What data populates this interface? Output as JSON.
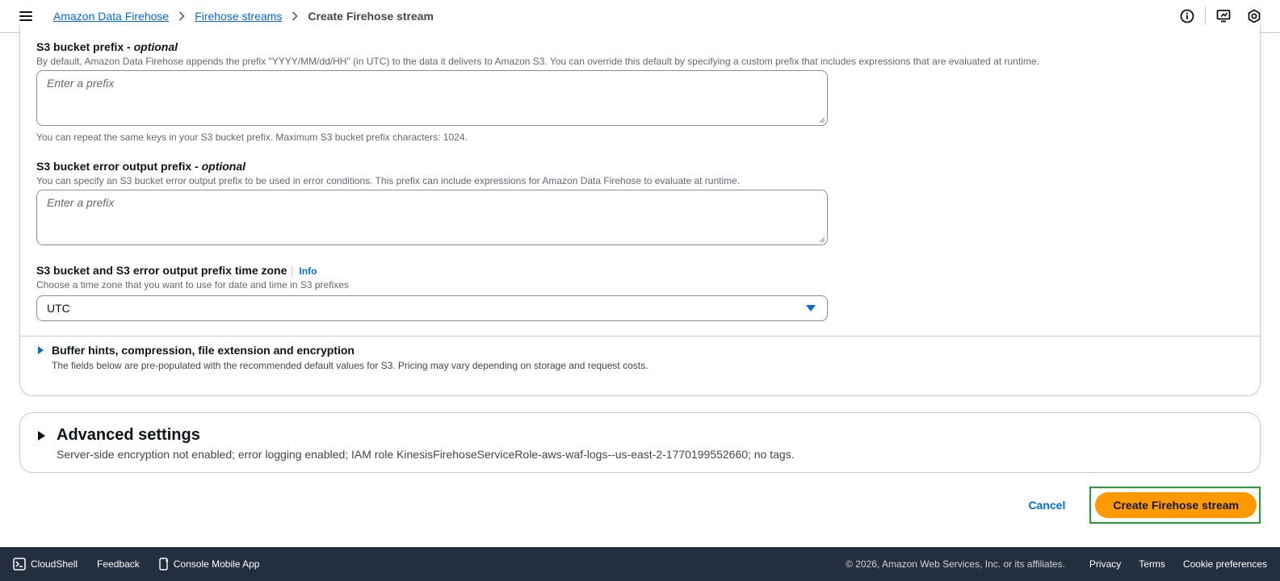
{
  "breadcrumb": {
    "items": [
      "Amazon Data Firehose",
      "Firehose streams"
    ],
    "current": "Create Firehose stream"
  },
  "top_icons": [
    "info-icon",
    "screen-feedback-icon",
    "settings-hex-icon"
  ],
  "fields": {
    "s3_prefix": {
      "label": "S3 bucket prefix - ",
      "optional": "optional",
      "description": "By default, Amazon Data Firehose appends the prefix \"YYYY/MM/dd/HH\" (in UTC) to the data it delivers to Amazon S3. You can override this default by specifying a custom prefix that includes expressions that are evaluated at runtime.",
      "placeholder": "Enter a prefix",
      "constraint": "You can repeat the same keys in your S3 bucket prefix. Maximum S3 bucket prefix characters: 1024."
    },
    "s3_error_prefix": {
      "label": "S3 bucket error output prefix - ",
      "optional": "optional",
      "description": "You can specify an S3 bucket error output prefix to be used in error conditions. This prefix can include expressions for Amazon Data Firehose to evaluate at runtime.",
      "placeholder": "Enter a prefix"
    },
    "timezone": {
      "label": "S3 bucket and S3 error output prefix time zone",
      "info": "Info",
      "description": "Choose a time zone that you want to use for date and time in S3 prefixes",
      "value": "UTC"
    }
  },
  "buffer_section": {
    "title": "Buffer hints, compression, file extension and encryption",
    "description": "The fields below are pre-populated with the recommended default values for S3. Pricing may vary depending on storage and request costs."
  },
  "advanced": {
    "title": "Advanced settings",
    "summary": "Server-side encryption not enabled; error logging enabled; IAM role KinesisFirehoseServiceRole-aws-waf-logs--us-east-2-1770199552660; no tags."
  },
  "actions": {
    "cancel": "Cancel",
    "create": "Create Firehose stream"
  },
  "footer": {
    "cloudshell": "CloudShell",
    "feedback": "Feedback",
    "mobile_app": "Console Mobile App",
    "copyright": "© 2026, Amazon Web Services, Inc. or its affiliates.",
    "privacy": "Privacy",
    "terms": "Terms",
    "cookies": "Cookie preferences"
  },
  "colors": {
    "link": "#006ce0",
    "primary_button": "#ff9900",
    "highlight_border": "#1aa52c",
    "footer_bg": "#232f3e"
  }
}
